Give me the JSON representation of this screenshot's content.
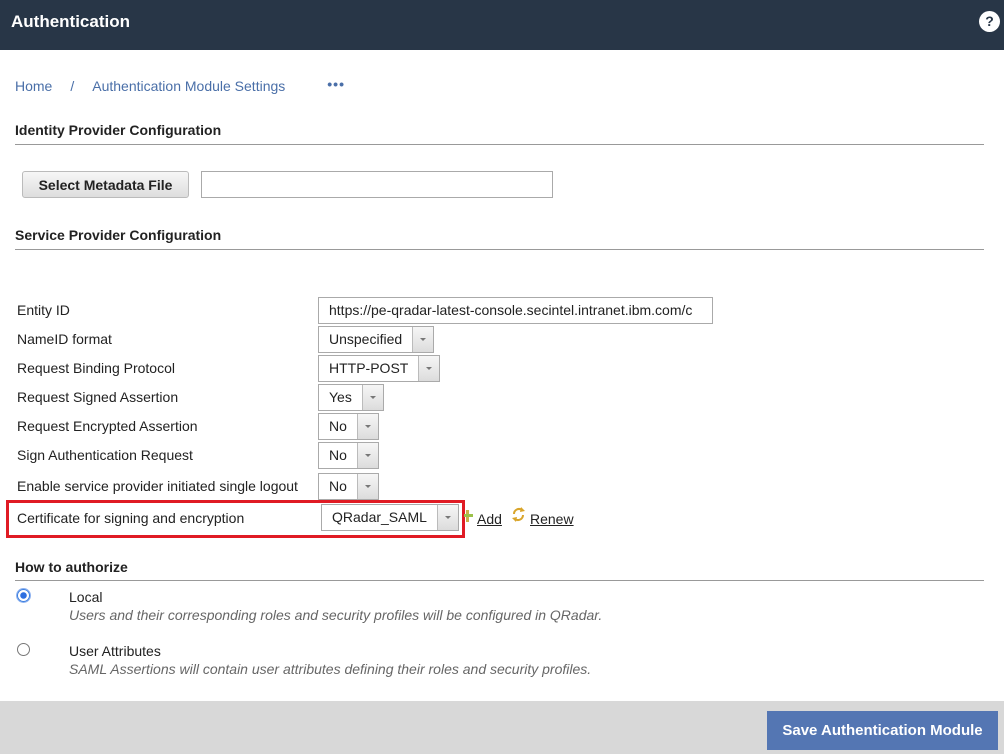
{
  "header": {
    "title": "Authentication",
    "help_label": "?"
  },
  "breadcrumb": {
    "items": [
      "Home",
      "Authentication Module Settings"
    ],
    "separator": "/",
    "more_label": "•••"
  },
  "identity_provider": {
    "title": "Identity Provider Configuration",
    "select_button_label": "Select Metadata File",
    "metadata_file_value": ""
  },
  "service_provider": {
    "title": "Service Provider Configuration",
    "fields": [
      {
        "label": "Entity ID",
        "value": "https://pe-qradar-latest-console.secintel.intranet.ibm.com/c",
        "type": "text"
      },
      {
        "label": "NameID format",
        "value": "Unspecified",
        "type": "select"
      },
      {
        "label": "Request Binding Protocol",
        "value": "HTTP-POST",
        "type": "select"
      },
      {
        "label": "Request Signed Assertion",
        "value": "Yes",
        "type": "select"
      },
      {
        "label": "Request Encrypted Assertion",
        "value": "No",
        "type": "select"
      },
      {
        "label": "Sign Authentication Request",
        "value": "No",
        "type": "select"
      },
      {
        "label": "Enable service provider initiated single logout",
        "value": "No",
        "type": "select"
      },
      {
        "label": "Certificate for signing and encryption",
        "value": "QRadar_SAML",
        "type": "select"
      }
    ],
    "cert_actions": {
      "add_label": "Add",
      "renew_label": "Renew"
    },
    "highlight_color": "#e01b24"
  },
  "authorize": {
    "title": "How to authorize",
    "options": [
      {
        "label": "Local",
        "description": "Users and their corresponding roles and security profiles will be configured in QRadar.",
        "selected": true
      },
      {
        "label": "User Attributes",
        "description": "SAML Assertions will contain user attributes defining their roles and security profiles.",
        "selected": false
      }
    ]
  },
  "footer": {
    "save_label": "Save Authentication Module",
    "save_color": "#5476b3"
  }
}
